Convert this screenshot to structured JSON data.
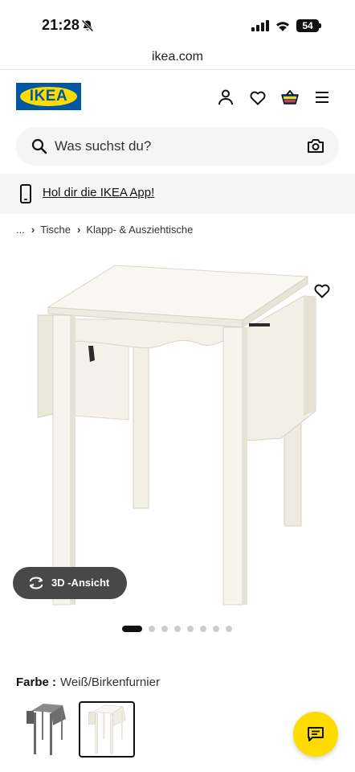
{
  "status": {
    "time": "21:28",
    "battery": "54",
    "icons": [
      "bell-slash-icon",
      "signal-bars-icon",
      "wifi-icon",
      "battery-icon"
    ]
  },
  "browser": {
    "url": "ikea.com"
  },
  "header": {
    "logo_text": "IKEA",
    "brand_colors": {
      "blue": "#0058a3",
      "yellow": "#ffdb00"
    },
    "icons": [
      "user-icon",
      "heart-icon",
      "shopping-bag-icon",
      "menu-icon"
    ]
  },
  "search": {
    "placeholder": "Was suchst du?"
  },
  "app_banner": {
    "label": "Hol dir die IKEA App!"
  },
  "breadcrumb": {
    "ellipsis": "...",
    "items": [
      "Tische",
      "Klapp- & Ausziehtische"
    ]
  },
  "gallery": {
    "view3d_label": "3D -Ansicht",
    "image_count": 8,
    "active_index": 0
  },
  "product": {
    "color_label": "Farbe :",
    "color_value": "Weiß/Birkenfurnier",
    "variants": [
      {
        "name": "grey",
        "color": "#6b6b6b",
        "selected": false
      },
      {
        "name": "white",
        "color": "#f6f5ee",
        "selected": true
      }
    ]
  }
}
